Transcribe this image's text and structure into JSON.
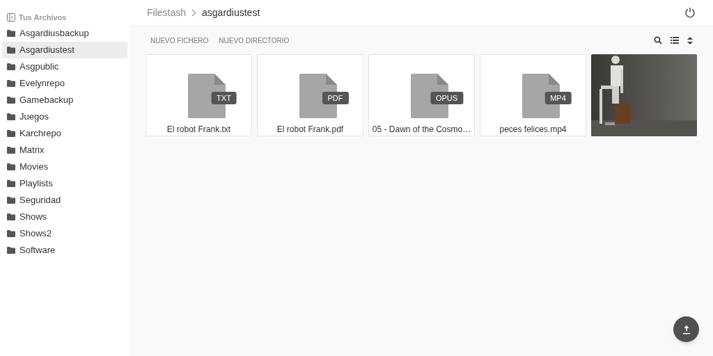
{
  "sidebar": {
    "title": "Tus Archivos",
    "items": [
      {
        "label": "Asgardiusbackup",
        "selected": false
      },
      {
        "label": "Asgardiustest",
        "selected": true
      },
      {
        "label": "Asgpublic",
        "selected": false
      },
      {
        "label": "Evelynrepo",
        "selected": false
      },
      {
        "label": "Gamebackup",
        "selected": false
      },
      {
        "label": "Juegos",
        "selected": false
      },
      {
        "label": "Karchrepo",
        "selected": false
      },
      {
        "label": "Matrix",
        "selected": false
      },
      {
        "label": "Movies",
        "selected": false
      },
      {
        "label": "Playlists",
        "selected": false
      },
      {
        "label": "Seguridad",
        "selected": false
      },
      {
        "label": "Shows",
        "selected": false
      },
      {
        "label": "Shows2",
        "selected": false
      },
      {
        "label": "Software",
        "selected": false
      }
    ]
  },
  "breadcrumb": [
    "Filestash",
    "asgardiustest"
  ],
  "actions": [
    "NUEVO FICHERO",
    "NUEVO DIRECTORIO"
  ],
  "files": [
    {
      "kind": "file",
      "ext": "TXT",
      "name": "El robot Frank.txt"
    },
    {
      "kind": "file",
      "ext": "PDF",
      "name": "El robot Frank.pdf"
    },
    {
      "kind": "file",
      "ext": "OPUS",
      "name": "05 - Dawn of the Cosmo…"
    },
    {
      "kind": "file",
      "ext": "MP4",
      "name": "peces felices.mp4"
    },
    {
      "kind": "picture"
    }
  ]
}
